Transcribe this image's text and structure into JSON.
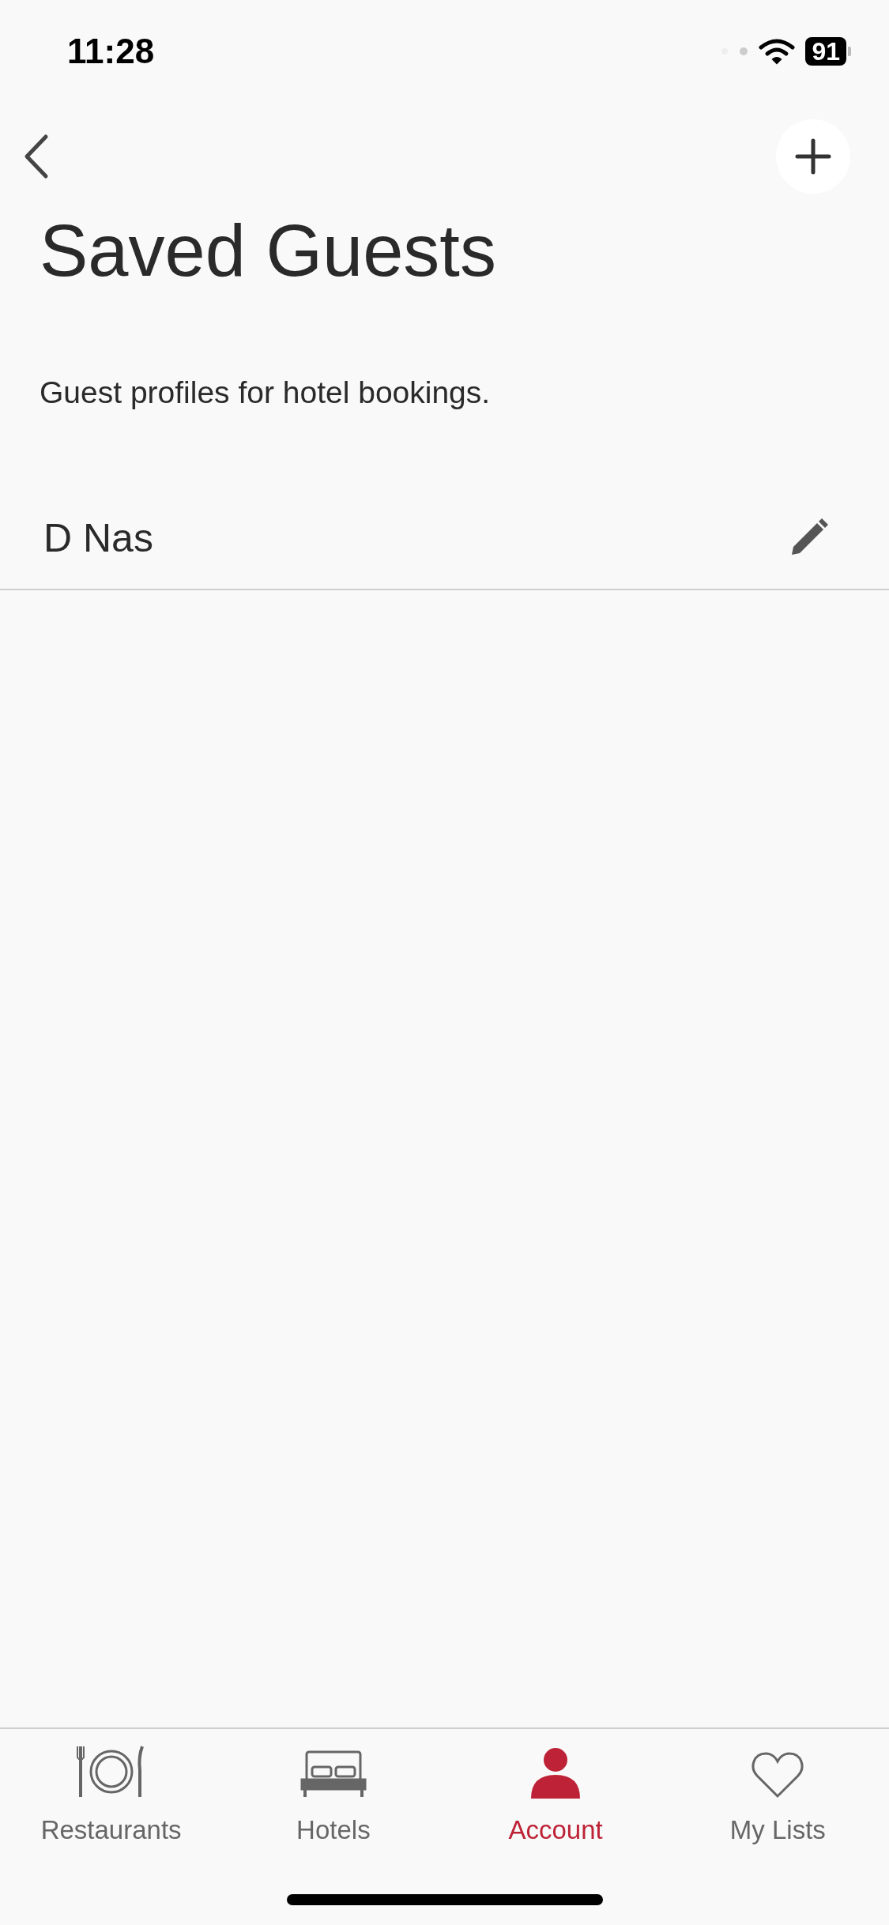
{
  "status_bar": {
    "time": "11:28",
    "battery": "91"
  },
  "header": {
    "title": "Saved Guests",
    "subtitle": "Guest profiles for hotel bookings."
  },
  "guests": [
    {
      "name": "D Nas"
    }
  ],
  "tab_bar": [
    {
      "kind": "restaurants",
      "label": "Restaurants",
      "selected": false
    },
    {
      "kind": "hotels",
      "label": "Hotels",
      "selected": false
    },
    {
      "kind": "account",
      "label": "Account",
      "selected": true
    },
    {
      "kind": "lists",
      "label": "My Lists",
      "selected": false
    }
  ]
}
